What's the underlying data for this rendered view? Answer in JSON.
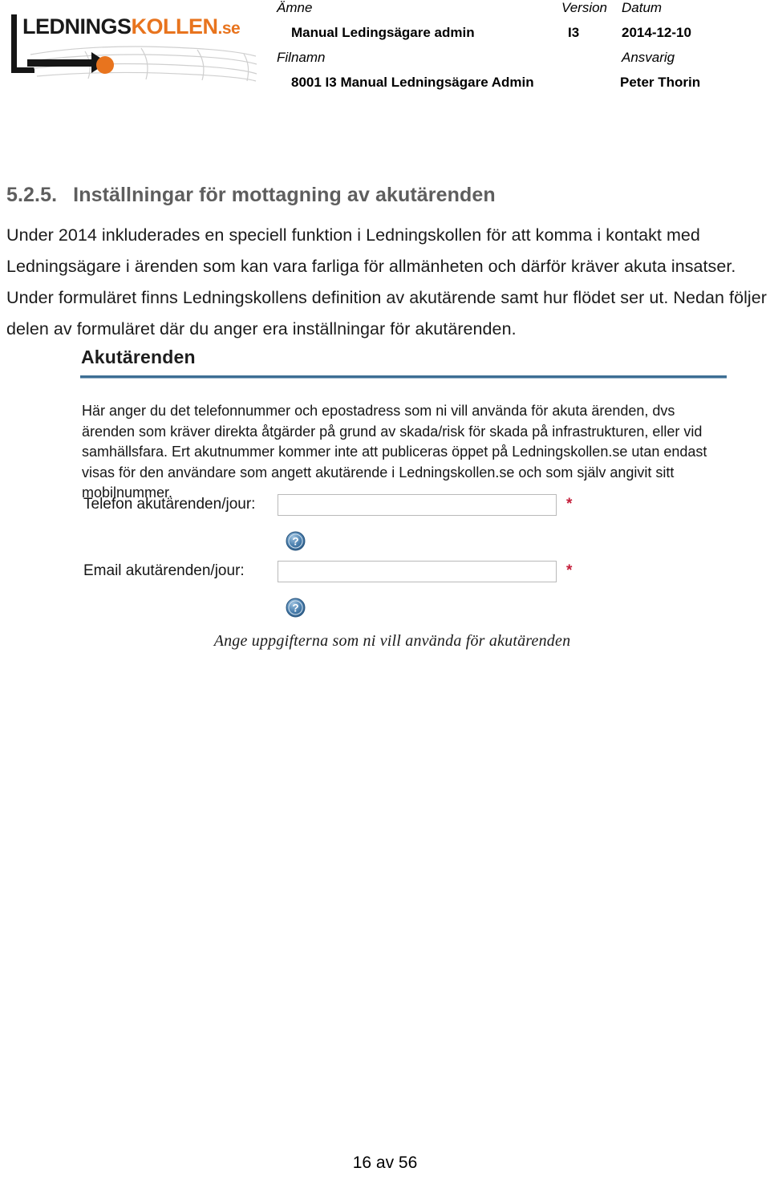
{
  "header": {
    "logo": {
      "word_dark": "LEDNINGS",
      "word_orange": "KOLLEN",
      "word_suffix": ".se",
      "dot_color": "#E8741E",
      "dark_color": "#1a1a1a"
    },
    "labels": {
      "amne": "Ämne",
      "version": "Version",
      "datum": "Datum",
      "filnamn": "Filnamn",
      "ansvarig": "Ansvarig"
    },
    "values": {
      "amne": "Manual Ledingsägare admin",
      "version": "I3",
      "datum": "2014-12-10",
      "filnamn": "8001 I3 Manual Ledningsägare Admin",
      "ansvarig": "Peter Thorin"
    }
  },
  "section": {
    "number": "5.2.5.",
    "title": "Inställningar för mottagning av akutärenden",
    "title_color": "#5e5e5e",
    "paragraph": "Under 2014 inkluderades en speciell funktion i Ledningskollen för att komma i kontakt med Ledningsägare i ärenden som kan vara farliga för allmänheten och därför kräver akuta insatser. Under formuläret finns Ledningskollens definition av akutärende samt hur flödet ser ut. Nedan följer delen av formuläret där du anger era inställningar för akutärenden."
  },
  "form_screenshot": {
    "title": "Akutärenden",
    "rule_color": "#3d6e94",
    "description": "Här anger du det telefonnummer och epostadress som ni vill använda för akuta ärenden, dvs ärenden som kräver direkta åtgärder på grund av skada/risk för skada på infrastrukturen, eller vid samhällsfara. Ert akutnummer kommer inte att publiceras öppet på Ledningskollen.se utan endast visas för den användare som angett akutärende i Ledningskollen.se och som själv angivit sitt mobilnummer.",
    "fields": [
      {
        "label": "Telefon akutärenden/jour:",
        "value": "",
        "placeholder": "",
        "required_marker": "*",
        "help_icon": "help-circle-icon"
      },
      {
        "label": "Email akutärenden/jour:",
        "value": "",
        "placeholder": "",
        "required_marker": "*",
        "help_icon": "help-circle-icon"
      }
    ],
    "required_color": "#C41E3A"
  },
  "figure_caption": "Ange uppgifterna som ni vill använda för akutärenden",
  "footer": {
    "page_text": "16 av 56"
  }
}
